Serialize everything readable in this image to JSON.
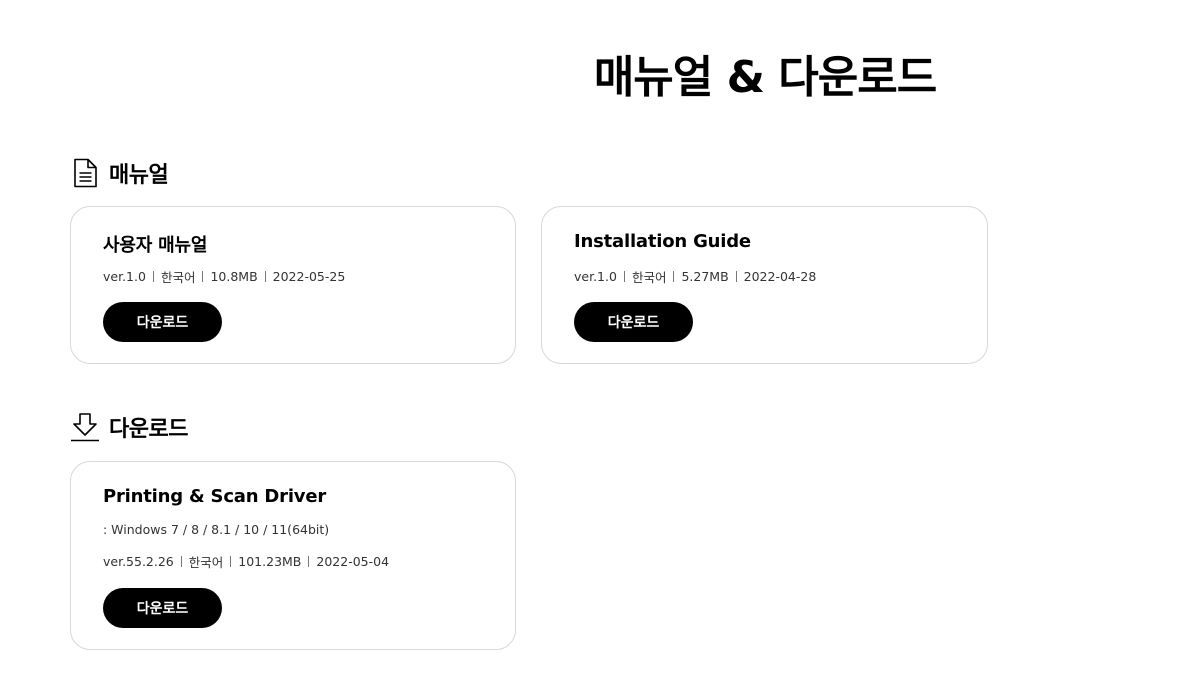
{
  "page": {
    "title": "매뉴얼 & 다운로드"
  },
  "sections": {
    "manual": {
      "label": "매뉴얼",
      "icon": "document-icon",
      "cards": [
        {
          "title": "사용자 매뉴얼",
          "version": "ver.1.0",
          "language": "한국어",
          "size": "10.8MB",
          "date": "2022-05-25",
          "button": "다운로드"
        },
        {
          "title": "Installation Guide",
          "version": "ver.1.0",
          "language": "한국어",
          "size": "5.27MB",
          "date": "2022-04-28",
          "button": "다운로드"
        }
      ]
    },
    "download": {
      "label": "다운로드",
      "icon": "download-arrow-icon",
      "cards": [
        {
          "title": "Printing & Scan Driver",
          "note": ": Windows 7 / 8 / 8.1 / 10 / 11(64bit)",
          "version": "ver.55.2.26",
          "language": "한국어",
          "size": "101.23MB",
          "date": "2022-05-04",
          "button": "다운로드"
        }
      ]
    }
  }
}
